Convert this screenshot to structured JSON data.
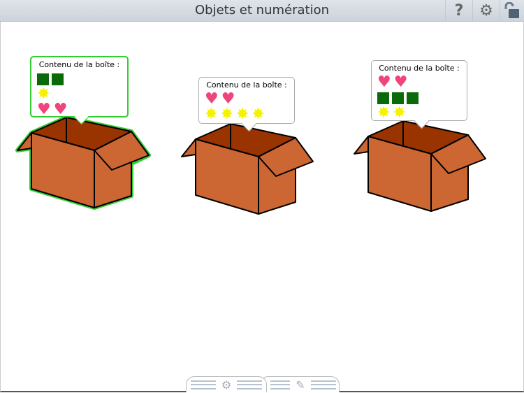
{
  "header": {
    "title": "Objets et numération",
    "help_icon": "?",
    "settings_icon": "⚙",
    "lock_icon": "🔓"
  },
  "boxes": [
    {
      "label": "Contenu de la boîte :",
      "selected": true,
      "rows": [
        [
          "square",
          "square"
        ],
        [
          "star"
        ],
        [
          "heart",
          "heart"
        ]
      ]
    },
    {
      "label": "Contenu de la boîte :",
      "selected": false,
      "rows": [
        [
          "heart",
          "heart"
        ],
        [
          "star",
          "star",
          "star",
          "star"
        ]
      ]
    },
    {
      "label": "Contenu de la boîte :",
      "selected": false,
      "rows": [
        [
          "heart",
          "heart"
        ],
        [
          "square",
          "square",
          "square"
        ],
        [
          "star",
          "star"
        ]
      ]
    }
  ],
  "colors": {
    "box_front": "#cc6633",
    "box_inside": "#993300",
    "selection": "#33cc33",
    "square": "#0a6a0a",
    "star": "#f5f200",
    "heart": "#f0457a"
  },
  "bottom_tabs": {
    "settings_icon": "⚙",
    "edit_icon": "✎"
  }
}
